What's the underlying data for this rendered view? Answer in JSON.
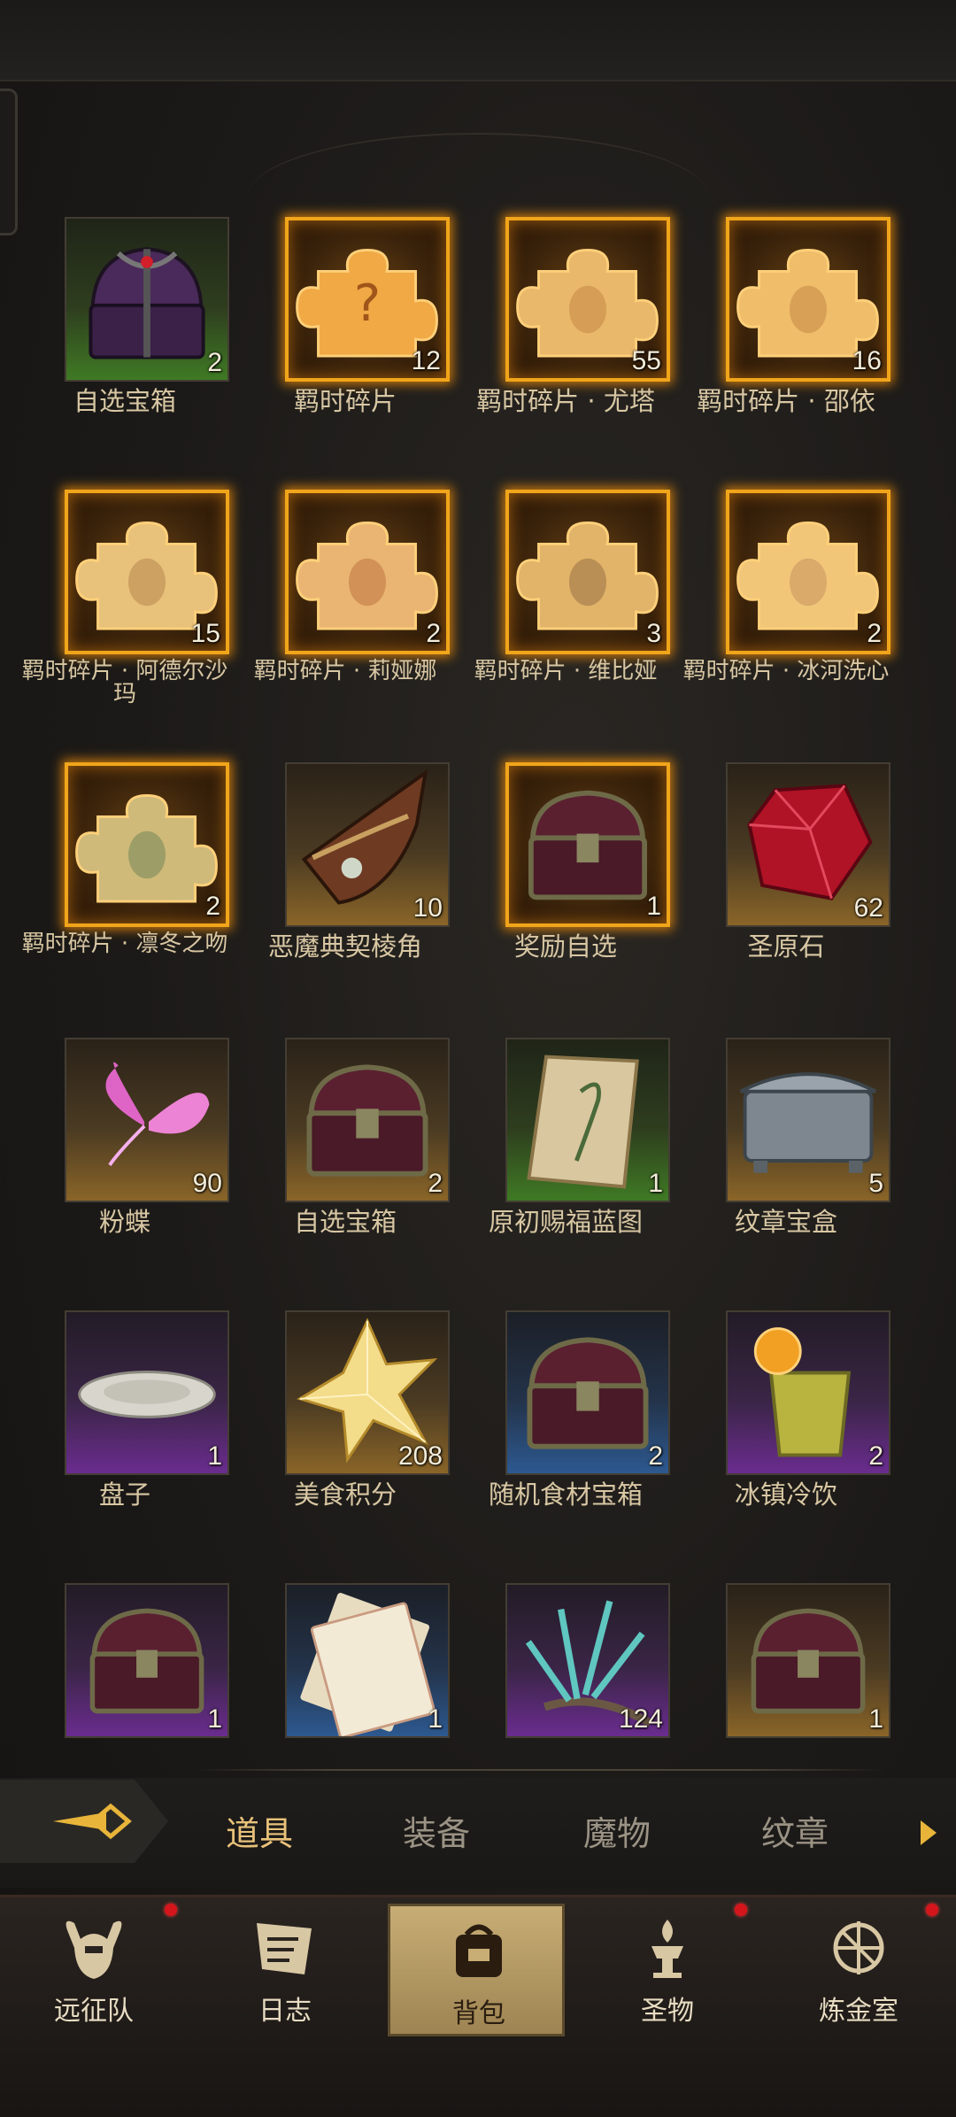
{
  "items": [
    {
      "label": "自选宝箱",
      "count": "2",
      "rarity": "green",
      "icon": "chest-purple-icon"
    },
    {
      "label": "羁时碎片",
      "count": "12",
      "rarity": "glow",
      "icon": "puzzle-question-icon"
    },
    {
      "label": "羁时碎片 · 尤塔",
      "count": "55",
      "rarity": "glow",
      "icon": "puzzle-icon"
    },
    {
      "label": "羁时碎片 · 邵依",
      "count": "16",
      "rarity": "glow",
      "icon": "puzzle-icon"
    },
    {
      "label": "羁时碎片 · 阿德尔沙玛",
      "count": "15",
      "rarity": "glow",
      "icon": "puzzle-icon"
    },
    {
      "label": "羁时碎片 · 莉娅娜",
      "count": "2",
      "rarity": "glow",
      "icon": "puzzle-icon"
    },
    {
      "label": "羁时碎片 · 维比娅",
      "count": "3",
      "rarity": "glow",
      "icon": "puzzle-icon"
    },
    {
      "label": "羁时碎片 · 冰河洗心",
      "count": "2",
      "rarity": "glow",
      "icon": "puzzle-icon"
    },
    {
      "label": "羁时碎片 · 凛冬之吻",
      "count": "2",
      "rarity": "glow",
      "icon": "puzzle-icon"
    },
    {
      "label": "恶魔典契棱角",
      "count": "10",
      "rarity": "gold",
      "icon": "demon-contract-shard-icon"
    },
    {
      "label": "奖励自选",
      "count": "1",
      "rarity": "glow",
      "icon": "chest-icon"
    },
    {
      "label": "圣原石",
      "count": "62",
      "rarity": "gold",
      "icon": "ruby-icon"
    },
    {
      "label": "粉蝶",
      "count": "90",
      "rarity": "gold",
      "icon": "butterfly-icon"
    },
    {
      "label": "自选宝箱",
      "count": "2",
      "rarity": "gold",
      "icon": "chest-icon"
    },
    {
      "label": "原初赐福蓝图",
      "count": "1",
      "rarity": "green",
      "icon": "scroll-icon"
    },
    {
      "label": "纹章宝盒",
      "count": "5",
      "rarity": "gold",
      "icon": "silver-box-icon"
    },
    {
      "label": "盘子",
      "count": "1",
      "rarity": "purple",
      "icon": "plate-icon"
    },
    {
      "label": "美食积分",
      "count": "208",
      "rarity": "gold",
      "icon": "star-crystal-icon"
    },
    {
      "label": "随机食材宝箱",
      "count": "2",
      "rarity": "blue",
      "icon": "chest-icon"
    },
    {
      "label": "冰镇冷饮",
      "count": "2",
      "rarity": "purple",
      "icon": "drink-icon"
    },
    {
      "label": "",
      "count": "1",
      "rarity": "purple",
      "icon": "chest-icon"
    },
    {
      "label": "",
      "count": "1",
      "rarity": "blue",
      "icon": "paper-card-icon"
    },
    {
      "label": "",
      "count": "124",
      "rarity": "purple",
      "icon": "herb-branch-icon"
    },
    {
      "label": "",
      "count": "1",
      "rarity": "gold",
      "icon": "chest-icon"
    }
  ],
  "tabs": [
    "道具",
    "装备",
    "魔物",
    "纹章"
  ],
  "active_tab": "道具",
  "nav": [
    {
      "label": "远征队",
      "icon": "helmet-icon",
      "badge": true
    },
    {
      "label": "日志",
      "icon": "journal-icon",
      "badge": false
    },
    {
      "label": "背包",
      "icon": "backpack-icon",
      "badge": false
    },
    {
      "label": "圣物",
      "icon": "relic-icon",
      "badge": true
    },
    {
      "label": "炼金室",
      "icon": "alchemy-icon",
      "badge": true
    }
  ],
  "active_nav": "背包",
  "colors": {
    "accent": "#f0a51a",
    "badge": "#d4151b",
    "label": "#d8c7a3"
  }
}
